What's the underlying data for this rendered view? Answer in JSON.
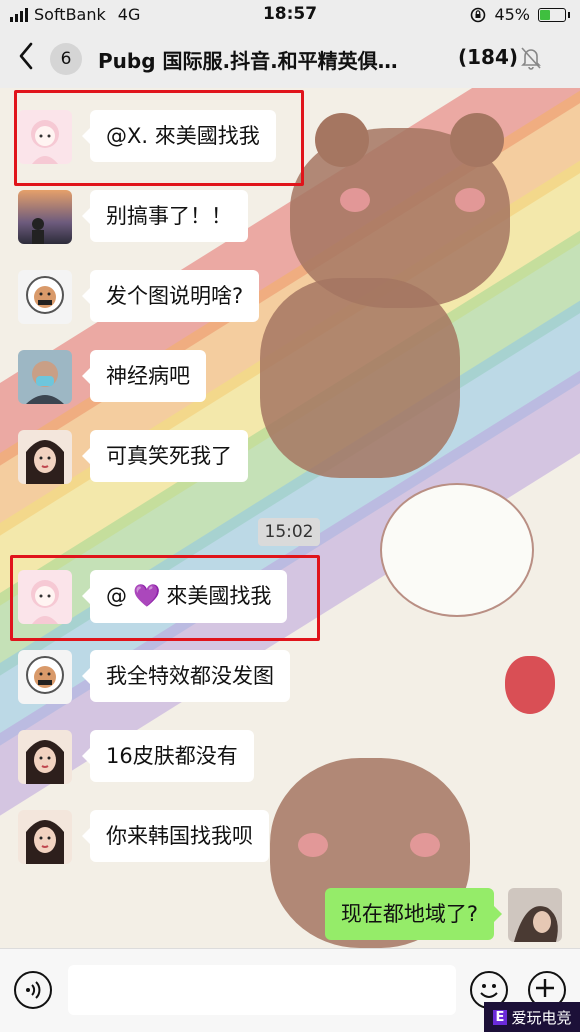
{
  "status_bar": {
    "carrier": "SoftBank",
    "network": "4G",
    "time": "18:57",
    "battery": "45%",
    "battery_level": 0.45
  },
  "header": {
    "back_badge": "6",
    "title": "Pubg 国际服.抖音.和平精英俱…",
    "member_count": "(184)",
    "mute_icon": "bell-slash-icon"
  },
  "messages": [
    {
      "text": "@X. 來美國找我"
    },
    {
      "text": "别搞事了！！"
    },
    {
      "text": "发个图说明啥?"
    },
    {
      "text": "神经病吧"
    },
    {
      "text": "可真笑死我了"
    },
    {
      "prefix": "@",
      "emoji": "💜",
      "suffix": "來美國找我"
    },
    {
      "text": "我全特效都没发图"
    },
    {
      "text": "16皮肤都没有"
    },
    {
      "text": "你来韩国找我呗"
    },
    {
      "text": "现在都地域了?"
    }
  ],
  "timestamp": "15:02",
  "watermark": {
    "text": "爱玩电竞",
    "tag": "E"
  },
  "colors": {
    "highlight": "#e0141b",
    "my_bubble": "#95ec69",
    "other_bubble": "#ffffff"
  }
}
